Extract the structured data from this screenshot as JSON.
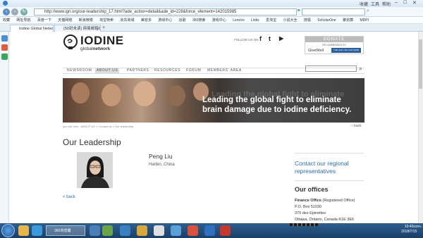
{
  "browser": {
    "window_controls": [
      "收藏",
      "工具",
      "帮助"
    ],
    "back_icon": "back-arrow-icon",
    "url": "http://www.ign.org/our-leadership_17.html?ade_action=detail&ade_id=228&force_element=142015985",
    "search_placeholder": "",
    "favorites": [
      "收藏",
      "网址导航",
      "百度一下",
      "天猫网络",
      "新浪微博",
      "淘宝特卖",
      "京东商城",
      "美容多",
      "游戏中心",
      "谷歌",
      "360搜索",
      "游戏中心",
      "Lenovo",
      "Links",
      "爱淘宝",
      "小说大全",
      "搜狐",
      "ScholarOne",
      "聚划算",
      "MDPI"
    ],
    "tabs": [
      {
        "label": "Iodine Global Netwo"
      },
      {
        "label": "(50封未读) 网易邮箱6"
      }
    ]
  },
  "header": {
    "logo_title": "IODINE",
    "logo_sub_light": "global",
    "logo_sub_bold": "network",
    "follow_label": "FOLLOW US ON",
    "social": [
      "f",
      "t",
      "▶"
    ],
    "donate_label": "DONATE",
    "recommended_label": "RECOMMENDED BY",
    "givewell_label": "GiveWell",
    "lifeyou_label": "THE LIFE YOU CAN SAVE"
  },
  "nav": {
    "items": [
      "NEWSROOM",
      "ABOUT US",
      "PARTNERS",
      "RESOURCES",
      "FORUM",
      "MEMBERS' AREA"
    ],
    "active": "ABOUT US",
    "search_placeholder": ""
  },
  "banner": {
    "line1": "Leading the global fight to eliminate",
    "line2": "brain damage due to iodine deficiency."
  },
  "breadcrumb": "you are here : ABOUT US » Contact us » Our leadership",
  "back_top": "‹ back",
  "page_title": "Our Leadership",
  "person": {
    "name": "Peng Liu",
    "location": "Harbin, China"
  },
  "back_link": "< back",
  "sidebar": {
    "contact_title": "Contact our regional representatives",
    "offices_title": "Our offices",
    "office_name_bold": "Finance Office",
    "office_name_rest": " (Registered Office)",
    "address": [
      "P.O. Box 51030",
      "375 des Epinettes",
      "Ottawa, Ontario, Canada K1E 3E6"
    ]
  },
  "taskbar": {
    "window_label": "360浏览器",
    "time": "10:40",
    "date": "2018/7/15",
    "zoom": "100%"
  }
}
